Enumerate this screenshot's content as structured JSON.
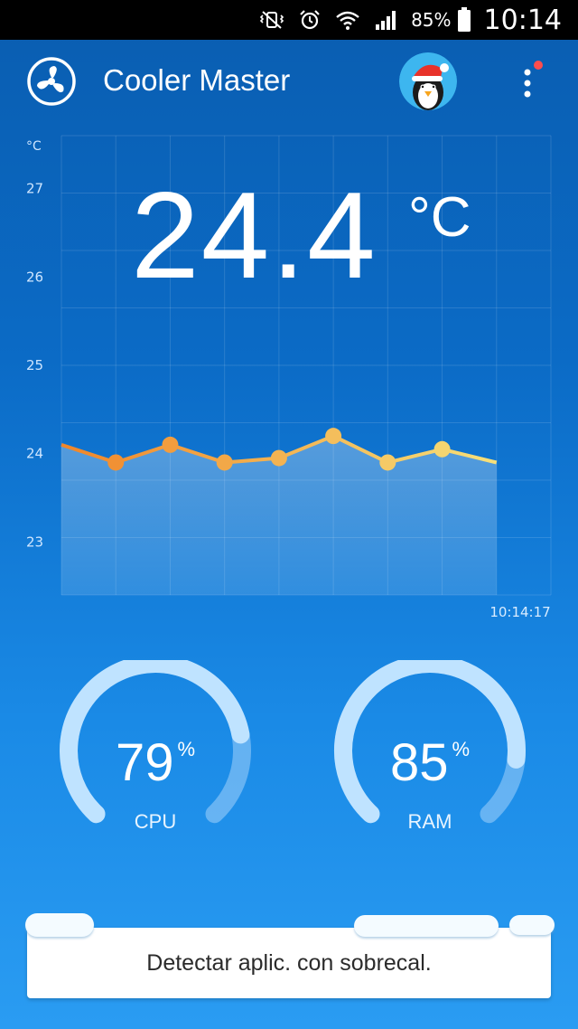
{
  "status_bar": {
    "battery_percent": "85%",
    "time": "10:14",
    "icons": [
      "mute-vibrate-icon",
      "alarm-icon",
      "wifi-icon",
      "signal-icon",
      "battery-icon"
    ]
  },
  "app_bar": {
    "title": "Cooler Master",
    "icons": [
      "fan-icon",
      "penguin-avatar-icon",
      "more-vert-icon"
    ],
    "notification_dot_color": "#ff4d4d"
  },
  "temperature": {
    "value": "24.4",
    "unit": "°C"
  },
  "chart_data": {
    "type": "area",
    "ylabel": "°C",
    "y_ticks": [
      "27",
      "26",
      "25",
      "24",
      "23"
    ],
    "ylim": [
      22.4,
      27.6
    ],
    "x_label_last": "10:14:17",
    "points": [
      24.1,
      23.9,
      24.1,
      23.9,
      23.95,
      24.2,
      23.9,
      24.05,
      23.9
    ],
    "marker_count": 7,
    "line_color_start": "#f0862a",
    "line_color_end": "#f6e07a"
  },
  "gauges": {
    "cpu": {
      "value": "79",
      "unit": "%",
      "label": "CPU",
      "fraction": 0.79
    },
    "ram": {
      "value": "85",
      "unit": "%",
      "label": "RAM",
      "fraction": 0.85
    }
  },
  "actions": {
    "detect_label": "Detectar aplic. con sobrecal."
  }
}
